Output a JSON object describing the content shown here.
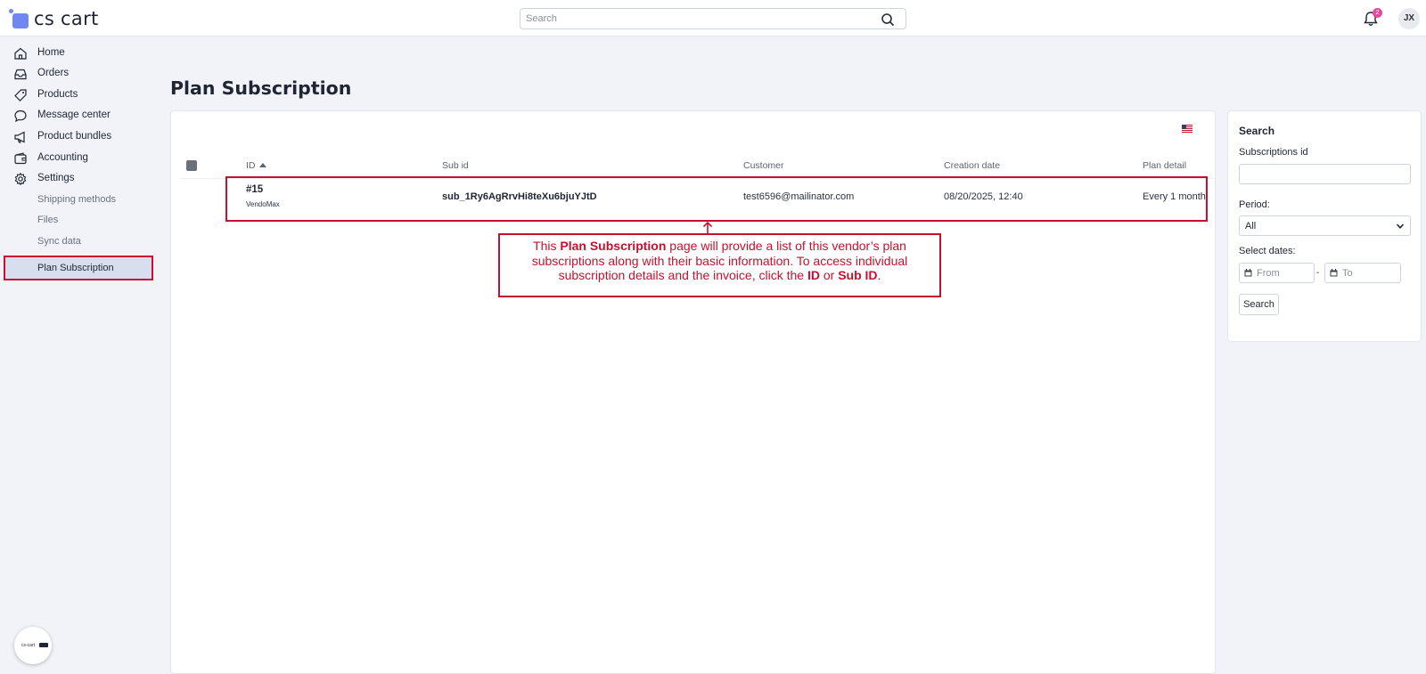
{
  "app": {
    "logo_text": "cs cart",
    "brand_color": "#6f87ee"
  },
  "header": {
    "search_placeholder": "Search",
    "notification_count": "2",
    "avatar_initials": "JX"
  },
  "sidebar": {
    "items": [
      {
        "label": "Home",
        "icon": "home-icon"
      },
      {
        "label": "Orders",
        "icon": "inbox-icon"
      },
      {
        "label": "Products",
        "icon": "tag-icon"
      },
      {
        "label": "Message center",
        "icon": "chat-icon"
      },
      {
        "label": "Product bundles",
        "icon": "megaphone-icon"
      },
      {
        "label": "Accounting",
        "icon": "wallet-icon"
      },
      {
        "label": "Settings",
        "icon": "gear-icon"
      }
    ],
    "sub_items": [
      {
        "label": "Shipping methods"
      },
      {
        "label": "Files"
      },
      {
        "label": "Sync data"
      },
      {
        "label": "Plan Subscription",
        "active": true
      }
    ],
    "bottom_badge_text": "cs-cart"
  },
  "page": {
    "title": "Plan Subscription"
  },
  "table": {
    "columns": [
      "ID",
      "Sub id",
      "Customer",
      "Creation date",
      "Plan detail"
    ],
    "rows": [
      {
        "id": "#15",
        "vendor": "VendoMax",
        "sub_id": "sub_1Ry6AgRrvHi8teXu6bjuYJtD",
        "customer": "test6596@mailinator.com",
        "creation_date": "08/20/2025, 12:40",
        "plan_detail": "Every 1 month"
      }
    ]
  },
  "callout": {
    "t1": "This ",
    "b1": "Plan Subscription",
    "t2": " page will provide a list of this vendor’s plan subscriptions along with their basic information. To access individual subscription details and the invoice, click the ",
    "b2": "ID",
    "t3": " or ",
    "b3": "Sub ID",
    "t4": ".",
    "color": "#c8102e"
  },
  "search_panel": {
    "title": "Search",
    "subscriptions_id_label": "Subscriptions id",
    "period_label": "Period:",
    "period_value": "All",
    "select_dates_label": "Select dates:",
    "from_placeholder": "From",
    "to_placeholder": "To",
    "dash": "-",
    "button_label": "Search"
  }
}
